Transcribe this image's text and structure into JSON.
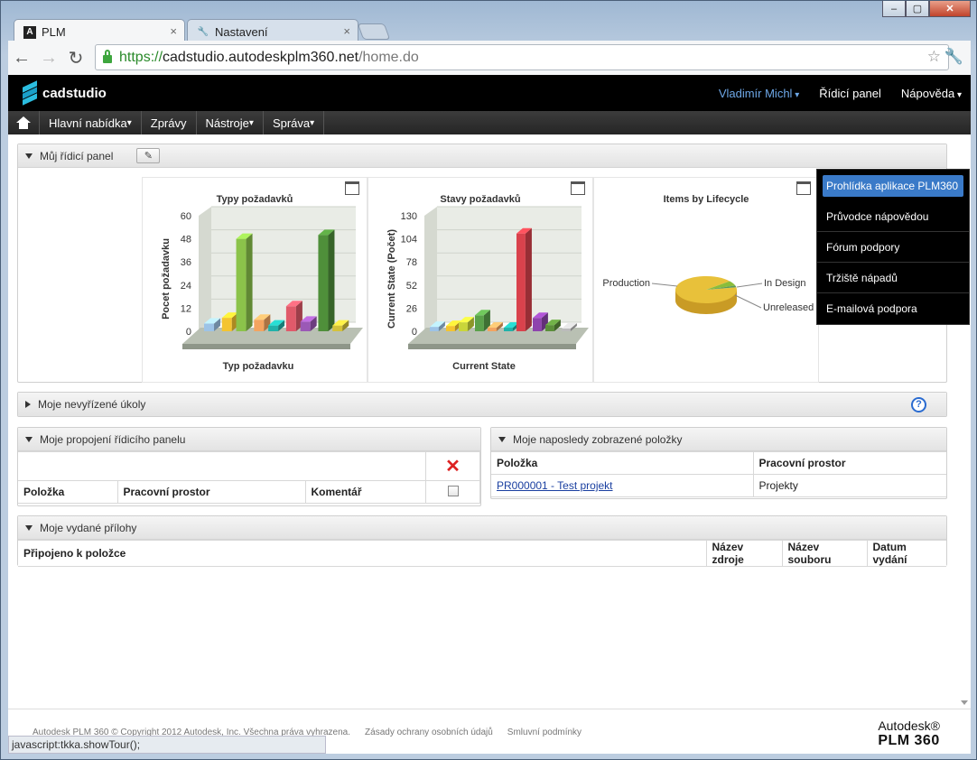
{
  "browser": {
    "tabs": [
      {
        "label": "PLM",
        "favicon": "A"
      },
      {
        "label": "Nastavení",
        "favicon": "wrench"
      }
    ],
    "url": {
      "scheme": "https://",
      "host": "cadstudio.autodeskplm360.net",
      "path": "/home.do"
    },
    "status_text": "javascript:tkka.showTour();"
  },
  "app": {
    "logo_text": "cadstudio",
    "user": "Vladimír Michl",
    "control_panel": "Řídicí panel",
    "help": "Nápověda"
  },
  "menu": {
    "items": [
      "Hlavní nabídka",
      "Zprávy",
      "Nástroje",
      "Správa"
    ]
  },
  "help_dropdown": {
    "items": [
      "Prohlídka aplikace PLM360",
      "Průvodce nápovědou",
      "Fórum podpory",
      "Tržiště nápadů",
      "E-mailová podpora"
    ]
  },
  "dashboard": {
    "title": "Můj řídicí panel"
  },
  "tasks": {
    "title": "Moje nevyřízené úkoly"
  },
  "links_panel": {
    "title": "Moje propojení řídicího panelu",
    "columns": [
      "Položka",
      "Pracovní prostor",
      "Komentář"
    ]
  },
  "recent_panel": {
    "title": "Moje naposledy zobrazené položky",
    "columns": [
      "Položka",
      "Pracovní prostor"
    ],
    "rows": [
      {
        "item": "PR000001 - Test projekt",
        "workspace": "Projekty"
      }
    ]
  },
  "attachments_panel": {
    "title": "Moje vydané přílohy",
    "columns": [
      "Připojeno k položce",
      "Název zdroje",
      "Název souboru",
      "Datum vydání"
    ]
  },
  "footer": {
    "copyright": "Autodesk PLM 360 © Copyright 2012 Autodesk, Inc. Všechna práva vyhrazena.",
    "privacy": "Zásady ochrany osobních údajů",
    "terms": "Smluvní podmínky",
    "brand_line1": "Autodesk®",
    "brand_line2": "PLM 360"
  },
  "chart_data": [
    {
      "type": "bar",
      "title": "Typy požadavků",
      "xlabel": "Typ požadavku",
      "ylabel": "Pocet požadavku",
      "yticks": [
        0,
        12,
        24,
        36,
        48,
        60
      ],
      "ylim": [
        0,
        60
      ],
      "values": [
        4,
        7,
        48,
        6,
        3,
        13,
        5,
        50,
        3
      ],
      "colors": [
        "#9dc3e6",
        "#f4c430",
        "#8bc34a",
        "#f4a460",
        "#20b2aa",
        "#e05a6a",
        "#9b59b6",
        "#4f8f3a",
        "#d4c23a"
      ]
    },
    {
      "type": "bar",
      "title": "Stavy požadavků",
      "xlabel": "Current State",
      "ylabel": "Current State (Počet)",
      "yticks": [
        0,
        26,
        52,
        78,
        104,
        130
      ],
      "ylim": [
        0,
        130
      ],
      "values": [
        5,
        6,
        10,
        18,
        4,
        4,
        110,
        15,
        7,
        3
      ],
      "colors": [
        "#9dc3e6",
        "#f4c430",
        "#c9d63a",
        "#5aa14a",
        "#f4a460",
        "#20b2aa",
        "#d9424c",
        "#8e44ad",
        "#5b8f3a",
        "#bbbbbb"
      ]
    },
    {
      "type": "pie",
      "title": "Items by Lifecycle",
      "labels": [
        "Production",
        "In Design",
        "Unreleased"
      ],
      "values": [
        92,
        6,
        2
      ],
      "colors": [
        "#e8c13a",
        "#8bbd3a",
        "#5a9a5a"
      ]
    }
  ]
}
